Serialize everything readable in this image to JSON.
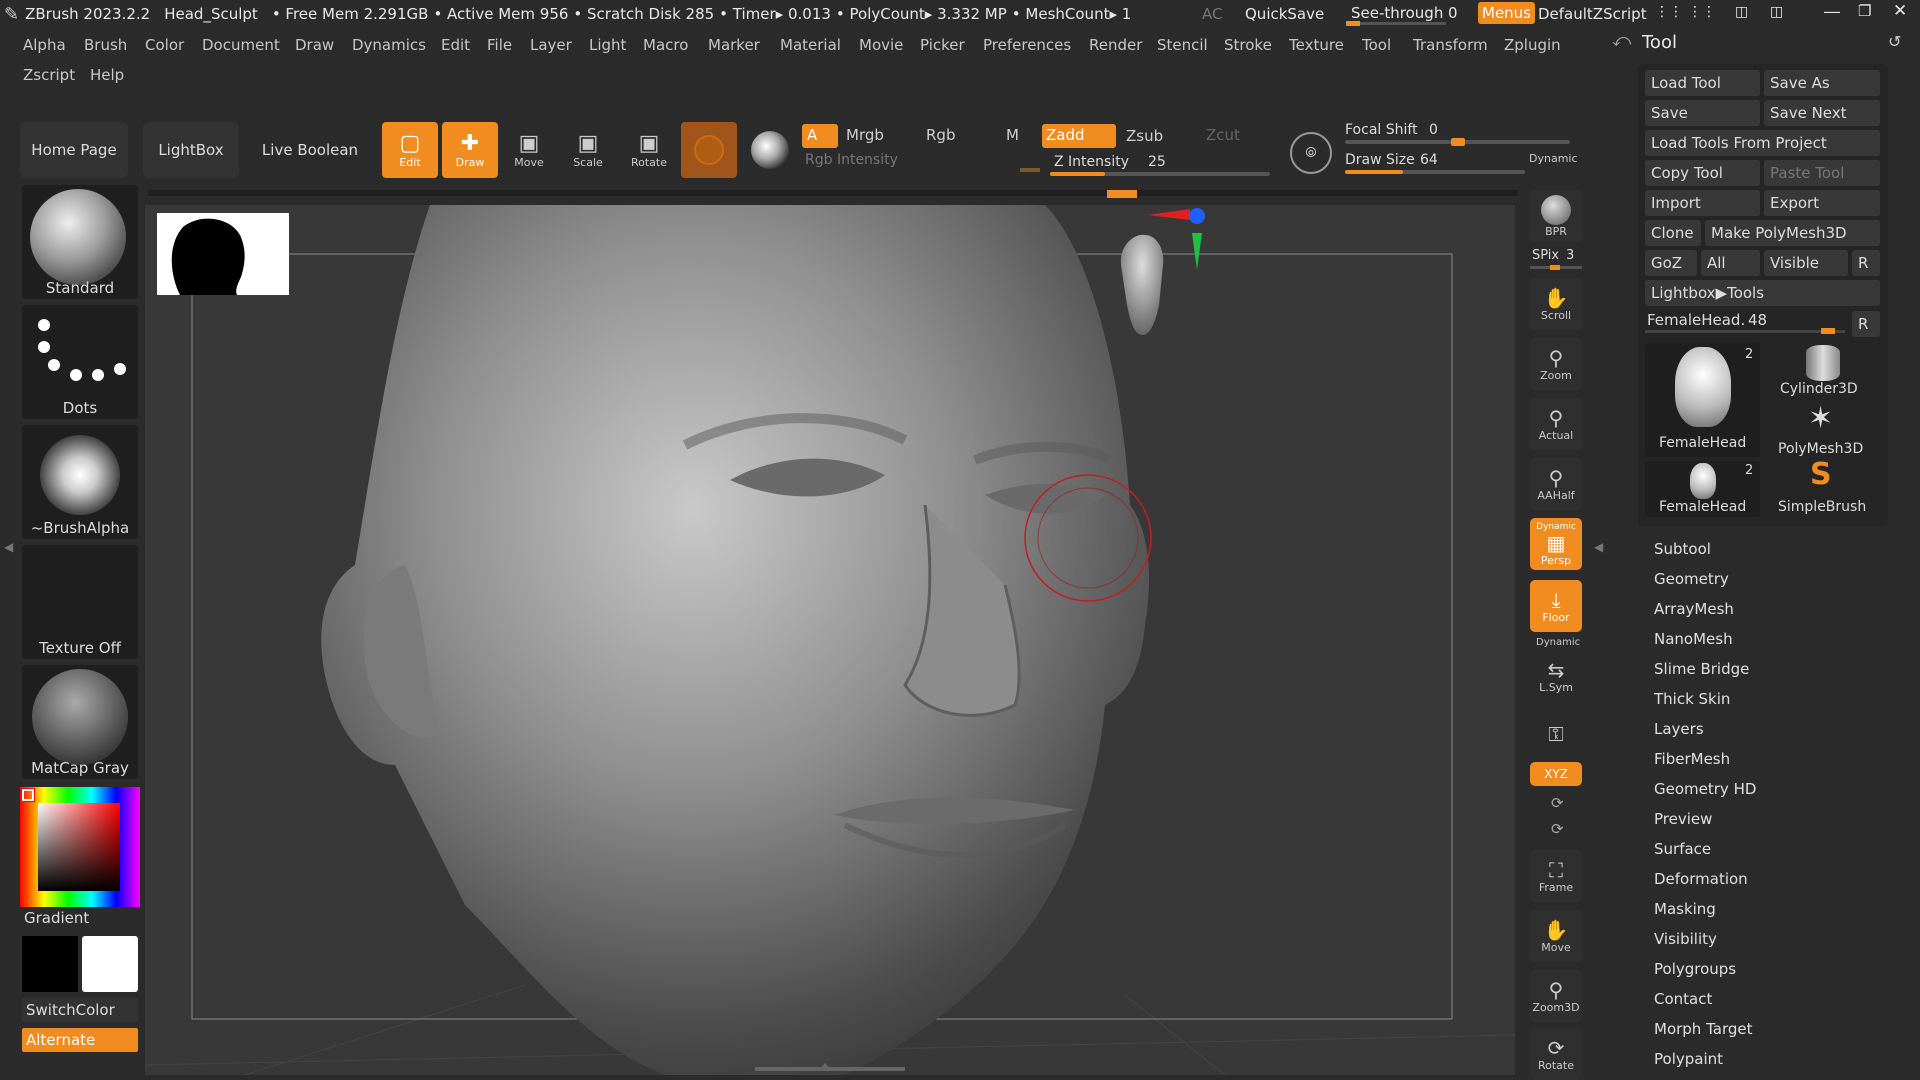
{
  "title": {
    "app": "ZBrush 2023.2.2",
    "doc": "Head_Sculpt",
    "free_mem": "• Free Mem 2.291GB",
    "active_mem": "• Active Mem 956",
    "scratch": "• Scratch Disk 285",
    "timer": "• Timer▸ 0.013",
    "polycount": "• PolyCount▸ 3.332 MP",
    "meshcount": "• MeshCount▸ 1",
    "ac": "AC",
    "quicksave": "QuickSave",
    "see_through_label": "See-through",
    "see_through_value": "0",
    "menus": "Menus",
    "script": "DefaultZScript"
  },
  "menu": {
    "row1": [
      "Alpha",
      "Brush",
      "Color",
      "Document",
      "Draw",
      "Dynamics",
      "Edit",
      "File",
      "Layer",
      "Light",
      "Macro",
      "Marker",
      "Material",
      "Movie",
      "Picker",
      "Preferences",
      "Render",
      "Stencil",
      "Stroke",
      "Texture",
      "Tool",
      "Transform",
      "Zplugin"
    ],
    "row2": [
      "Zscript",
      "Help"
    ]
  },
  "shelf": {
    "home_page": "Home Page",
    "lightbox": "LightBox",
    "live_boolean": "Live Boolean",
    "edit": "Edit",
    "draw": "Draw",
    "move": "Move",
    "scale": "Scale",
    "rotate": "Rotate",
    "a": "A",
    "mrgb": "Mrgb",
    "rgb": "Rgb",
    "m": "M",
    "zadd": "Zadd",
    "zsub": "Zsub",
    "zcut": "Zcut",
    "rgb_intensity": "Rgb Intensity",
    "z_intensity_label": "Z Intensity",
    "z_intensity": "25",
    "focal_shift_label": "Focal Shift",
    "focal_shift": "0",
    "draw_size_label": "Draw Size",
    "draw_size": "64",
    "dynamic": "Dynamic"
  },
  "left": {
    "brush": "Standard",
    "stroke": "Dots",
    "alpha": "~BrushAlpha",
    "texture": "Texture Off",
    "material": "MatCap Gray",
    "gradient": "Gradient",
    "switchcolor": "SwitchColor",
    "alternate": "Alternate"
  },
  "rightbar": {
    "bpr": "BPR",
    "spix_label": "SPix",
    "spix": "3",
    "scroll": "Scroll",
    "zoom": "Zoom",
    "actual": "Actual",
    "aahalf": "AAHalf",
    "dynamic": "Dynamic",
    "persp": "Persp",
    "floor": "Floor",
    "dynamic2": "Dynamic",
    "lsym": "L.Sym",
    "xyz": "XYZ",
    "frame": "Frame",
    "move": "Move",
    "zoom3d": "Zoom3D",
    "rotate": "Rotate"
  },
  "tool": {
    "title": "Tool",
    "load_tool": "Load Tool",
    "save_as": "Save As",
    "save": "Save",
    "save_next": "Save Next",
    "load_from_project": "Load Tools From Project",
    "copy_tool": "Copy Tool",
    "paste_tool": "Paste Tool",
    "import": "Import",
    "export": "Export",
    "clone": "Clone",
    "make_polymesh": "Make PolyMesh3D",
    "goz": "GoZ",
    "all": "All",
    "visible": "Visible",
    "r": "R",
    "lightbox_tools": "Lightbox▶Tools",
    "current_label": "FemaleHead.",
    "current_value": "48",
    "r2": "R",
    "thumbs": [
      {
        "label": "FemaleHead",
        "count": "2"
      },
      {
        "label": "Cylinder3D",
        "count": ""
      },
      {
        "label": "PolyMesh3D",
        "count": ""
      },
      {
        "label": "FemaleHead",
        "count": "2"
      },
      {
        "label": "SimpleBrush",
        "count": ""
      }
    ],
    "sections": [
      "Subtool",
      "Geometry",
      "ArrayMesh",
      "NanoMesh",
      "Slime Bridge",
      "Thick Skin",
      "Layers",
      "FiberMesh",
      "Geometry HD",
      "Preview",
      "Surface",
      "Deformation",
      "Masking",
      "Visibility",
      "Polygroups",
      "Contact",
      "Morph Target",
      "Polypaint"
    ]
  },
  "colors": {
    "accent": "#f08c20",
    "bg": "#2b2b2b",
    "canvas": "#383838"
  },
  "levels": {
    "z_intensity_fraction": 0.25,
    "draw_size_fraction": 0.32,
    "focal_shift_fraction": 0.5,
    "femalehead_fraction": 0.95
  }
}
